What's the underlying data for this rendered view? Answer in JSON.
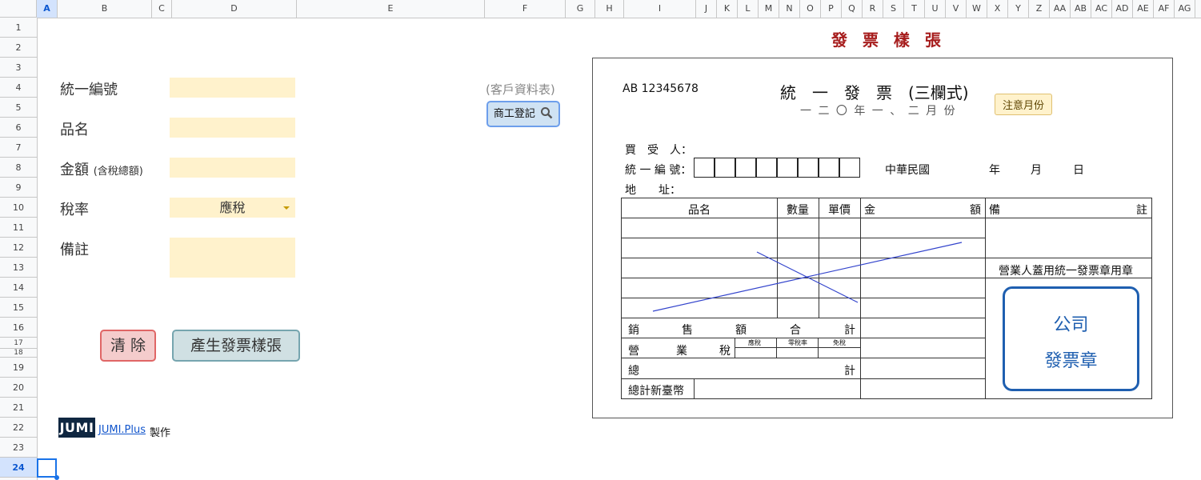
{
  "sheet": {
    "columns": [
      "A",
      "B",
      "C",
      "D",
      "E",
      "F",
      "G",
      "H",
      "I",
      "J",
      "K",
      "L",
      "M",
      "N",
      "O",
      "P",
      "Q",
      "R",
      "S",
      "T",
      "U",
      "V",
      "W",
      "X",
      "Y",
      "Z",
      "AA",
      "AB",
      "AC",
      "AD",
      "AE",
      "AF",
      "AG"
    ],
    "rows": [
      "1",
      "2",
      "3",
      "4",
      "5",
      "6",
      "7",
      "8",
      "9",
      "10",
      "11",
      "12",
      "13",
      "14",
      "15",
      "16",
      "17",
      "18",
      "19",
      "20",
      "21",
      "22",
      "23",
      "24"
    ],
    "selected_column": "A",
    "selected_row": "24"
  },
  "form": {
    "tax_id_label": "統一編號",
    "item_label": "品名",
    "amount_label": "金額",
    "amount_note": "(含稅總額)",
    "tax_rate_label": "稅率",
    "tax_rate_value": "應稅",
    "remark_label": "備註",
    "tax_id_value": "",
    "item_value": "",
    "amount_value": "",
    "remark_value": ""
  },
  "buttons": {
    "customer_sheet_link": "(客戶資料表)",
    "business_lookup": "商工登記",
    "clear": "清 除",
    "generate": "產生發票樣張"
  },
  "footer": {
    "logo": "JUMI",
    "link": "JUMI.Plus",
    "suffix": "製作"
  },
  "invoice": {
    "sheet_title": "發 票 樣 張",
    "number": "AB 12345678",
    "title": "統　一　發　票　(三欄式)",
    "period": "一 二 〇 年 一 、 二 月 份",
    "period_tooltip": "注意月份",
    "buyer_label": "買　受　人：",
    "tax_id_label": "統 一 編 號：",
    "address_label": "地　　址：",
    "roc_label": "中華民國",
    "year": "年",
    "month": "月",
    "day": "日",
    "col_item": "品名",
    "col_qty": "數量",
    "col_price": "單價",
    "col_amount_1": "金",
    "col_amount_2": "額",
    "col_remark_1": "備",
    "col_remark_2": "註",
    "stamp_note": "營業人蓋用統一發票章用章",
    "sales_1": "銷",
    "sales_2": "售",
    "sales_3": "額",
    "sales_4": "合",
    "sales_5": "計",
    "tax_1": "營",
    "tax_2": "業",
    "tax_3": "稅",
    "taxable": "應稅",
    "zero_rate": "零稅率",
    "exempt": "免稅",
    "total_1": "總",
    "total_2": "計",
    "total_twd": "總計新臺幣",
    "stamp_line1": "公司",
    "stamp_line2": "發票章"
  },
  "colors": {
    "field_bg": "#fff2cc",
    "title_red": "#a61c1c",
    "stamp_blue": "#1f5fb0",
    "clear_border": "#e06666",
    "generate_border": "#76a5af"
  }
}
